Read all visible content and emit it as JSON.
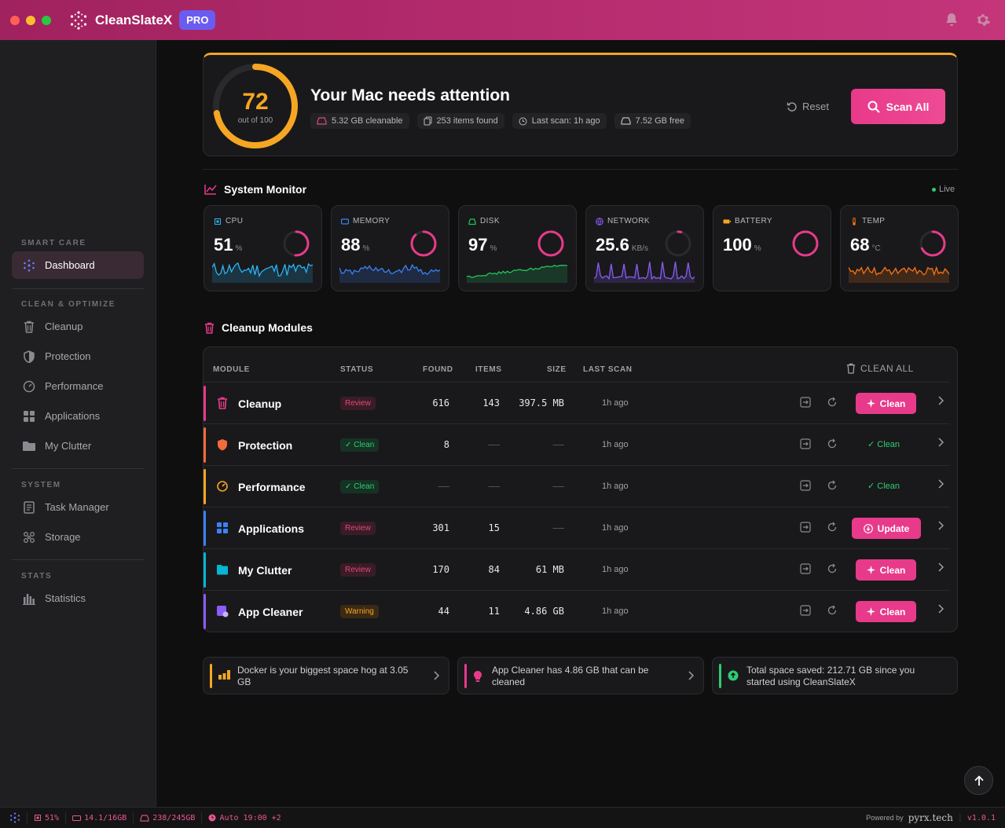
{
  "app": {
    "title": "CleanSlateX",
    "badge": "PRO"
  },
  "colors": {
    "accent": "#e83a8a",
    "warning": "#f5a623",
    "success": "#2ecc71",
    "titlebar": "#b22a6c"
  },
  "sidebar": {
    "sections": [
      {
        "label": "SMART CARE"
      },
      {
        "label": "CLEAN & OPTIMIZE"
      },
      {
        "label": "SYSTEM"
      },
      {
        "label": "STATS"
      }
    ],
    "items": [
      {
        "label": "Dashboard",
        "icon": "dashboard-icon",
        "active": true
      },
      {
        "label": "Cleanup",
        "icon": "trash-icon"
      },
      {
        "label": "Protection",
        "icon": "shield-icon"
      },
      {
        "label": "Performance",
        "icon": "gauge-icon"
      },
      {
        "label": "Applications",
        "icon": "grid-icon"
      },
      {
        "label": "My Clutter",
        "icon": "folder-icon"
      },
      {
        "label": "Task Manager",
        "icon": "clipboard-icon"
      },
      {
        "label": "Storage",
        "icon": "nodes-icon"
      },
      {
        "label": "Statistics",
        "icon": "bar-chart-icon"
      }
    ]
  },
  "hero": {
    "score": "72",
    "score_sub": "out of 100",
    "score_value": 72,
    "title": "Your Mac needs attention",
    "chips": [
      "5.32 GB cleanable",
      "253 items found",
      "Last scan: 1h ago",
      "7.52 GB free"
    ],
    "reset_label": "Reset",
    "scan_label": "Scan All"
  },
  "monitor": {
    "title": "System Monitor",
    "live": "Live",
    "cards": [
      {
        "label": "CPU",
        "value": "51",
        "unit": "%",
        "level": 0.51,
        "color": "#e83a8a",
        "spark": "#29b6f6"
      },
      {
        "label": "MEMORY",
        "value": "88",
        "unit": "%",
        "level": 0.88,
        "color": "#e83a8a",
        "spark": "#3b82f6"
      },
      {
        "label": "DISK",
        "value": "97",
        "unit": "%",
        "level": 0.97,
        "color": "#e83a8a",
        "spark": "#22c55e"
      },
      {
        "label": "NETWORK",
        "value": "25.6",
        "unit": "KB/s",
        "level": 0.04,
        "color": "#e83a8a",
        "spark": "#8b5cf6"
      },
      {
        "label": "BATTERY",
        "value": "100",
        "unit": "%",
        "level": 1.0,
        "color": "#e83a8a",
        "spark": ""
      },
      {
        "label": "TEMP",
        "value": "68",
        "unit": "°C",
        "level": 0.68,
        "color": "#e83a8a",
        "spark": "#f97316"
      }
    ]
  },
  "modules": {
    "title": "Cleanup Modules",
    "headers": [
      "MODULE",
      "STATUS",
      "FOUND",
      "ITEMS",
      "SIZE",
      "LAST SCAN"
    ],
    "clean_all": "CLEAN ALL",
    "rows": [
      {
        "name": "Cleanup",
        "status": "Review",
        "found": "616",
        "items": "143",
        "size": "397.5 MB",
        "last": "1h ago",
        "action": "Clean",
        "color": "#e83a8a"
      },
      {
        "name": "Protection",
        "status": "✓ Clean",
        "found": "8",
        "items": "——",
        "size": "——",
        "last": "1h ago",
        "action": "✓ Clean",
        "color": "#f26b3a"
      },
      {
        "name": "Performance",
        "status": "✓ Clean",
        "found": "——",
        "items": "——",
        "size": "——",
        "last": "1h ago",
        "action": "✓ Clean",
        "color": "#f5a623"
      },
      {
        "name": "Applications",
        "status": "Review",
        "found": "301",
        "items": "15",
        "size": "——",
        "last": "1h ago",
        "action": "Update",
        "color": "#3b82f6"
      },
      {
        "name": "My Clutter",
        "status": "Review",
        "found": "170",
        "items": "84",
        "size": "61 MB",
        "last": "1h ago",
        "action": "Clean",
        "color": "#06b6d4"
      },
      {
        "name": "App Cleaner",
        "status": "Warning",
        "found": "44",
        "items": "11",
        "size": "4.86 GB",
        "last": "1h ago",
        "action": "Clean",
        "color": "#8b5cf6"
      }
    ]
  },
  "tips": [
    {
      "text": "Docker is your biggest space hog at 3.05 GB",
      "color": "#f5a623"
    },
    {
      "text": "App Cleaner has 4.86 GB that can be cleaned",
      "color": "#e83a8a"
    },
    {
      "text": "Total space saved: 212.71 GB since you started using CleanSlateX",
      "color": "#2ecc71"
    }
  ],
  "statusbar": {
    "cpu": "51%",
    "mem": "14.1/16GB",
    "disk": "238/245GB",
    "auto": "Auto 19:00 +2",
    "powered": "Powered by",
    "brand": "pyrx.tech",
    "version": "v1.0.1"
  }
}
